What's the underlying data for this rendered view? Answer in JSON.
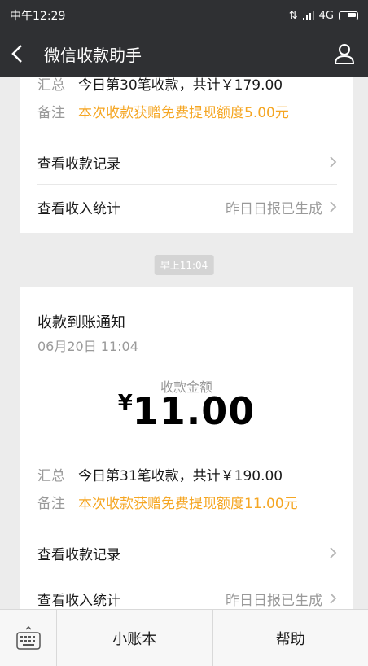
{
  "status_bar": {
    "time": "中午12:29",
    "network": "4G"
  },
  "header": {
    "title": "微信收款助手"
  },
  "card_prev": {
    "summary_key": "汇总",
    "summary_value": "今日第30笔收款，共计￥179.00",
    "note_key": "备注",
    "note_value": "本次收款获赠免费提现额度5.00元",
    "link_records": "查看收款记录",
    "link_stats": "查看收入统计",
    "stats_aside": "昨日日报已生成"
  },
  "timestamp_chip": "早上11:04",
  "card_main": {
    "title": "收款到账通知",
    "date": "06月20日 11:04",
    "amount_label": "收款金额",
    "currency": "¥",
    "amount": "11.00",
    "summary_key": "汇总",
    "summary_value": "今日第31笔收款，共计￥190.00",
    "note_key": "备注",
    "note_value": "本次收款获赠免费提现额度11.00元",
    "link_records": "查看收款记录",
    "link_stats": "查看收入统计",
    "stats_aside": "昨日日报已生成"
  },
  "bottom_menu": {
    "item1": "小账本",
    "item2": "帮助"
  },
  "colors": {
    "header_bg": "#2f3033",
    "note_orange": "#f5a623",
    "page_bg": "#ececec"
  }
}
